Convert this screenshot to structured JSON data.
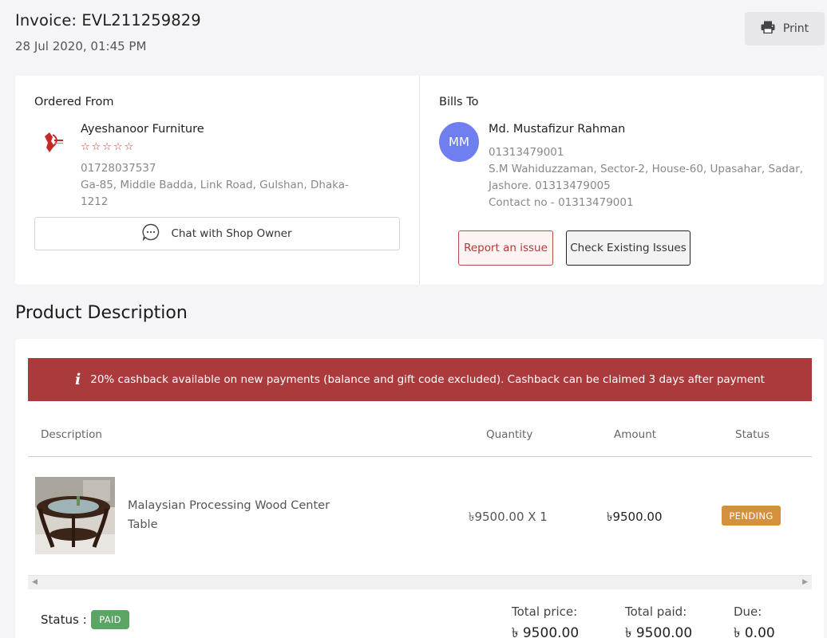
{
  "invoice": {
    "title": "Invoice: EVL211259829",
    "date": "28 Jul 2020, 01:45 PM",
    "print_label": "Print"
  },
  "ordered_from": {
    "label": "Ordered From",
    "shop_name": "Ayeshanoor Furniture",
    "rating_stars": "☆☆☆☆☆",
    "phone": "01728037537",
    "address_line1": "Ga-85, Middle Badda, Link Road, Gulshan, Dhaka-",
    "address_line2": "1212",
    "chat_label": "Chat with Shop Owner"
  },
  "bills_to": {
    "label": "Bills To",
    "initials": "MM",
    "name": "Md. Mustafizur Rahman",
    "phone": "01313479001",
    "address_line1": "S.M Wahiduzzaman, Sector-2, House-60, Upasahar, Sadar,",
    "address_line2": "Jashore. 01313479005",
    "contact": "Contact no - 01313479001",
    "report_label": "Report an issue",
    "check_label": "Check Existing Issues"
  },
  "product_section": {
    "heading": "Product Description",
    "cashback_notice": "20% cashback available on new payments (balance and gift code excluded). Cashback can be claimed 3 days after payment",
    "columns": {
      "description": "Description",
      "quantity": "Quantity",
      "amount": "Amount",
      "status": "Status"
    },
    "items": [
      {
        "name": "Malaysian Processing Wood Center Table",
        "quantity": "৳9500.00 X 1",
        "amount": "৳9500.00",
        "status": "PENDING"
      }
    ]
  },
  "summary": {
    "status_label": "Status :",
    "status_badge": "PAID",
    "total_price_label": "Total price:",
    "total_price": "৳ 9500.00",
    "total_paid_label": "Total paid:",
    "total_paid": "৳ 9500.00",
    "due_label": "Due:",
    "due": "৳ 0.00"
  },
  "colors": {
    "accent_red": "#ab3a3c",
    "pending": "#d4913d",
    "paid": "#5aa464",
    "avatar": "#6f7ff0"
  },
  "icons": {
    "print": "printer-icon",
    "chat": "chat-bubble-icon",
    "info": "info-icon",
    "shop_logo": "shop-logo"
  }
}
